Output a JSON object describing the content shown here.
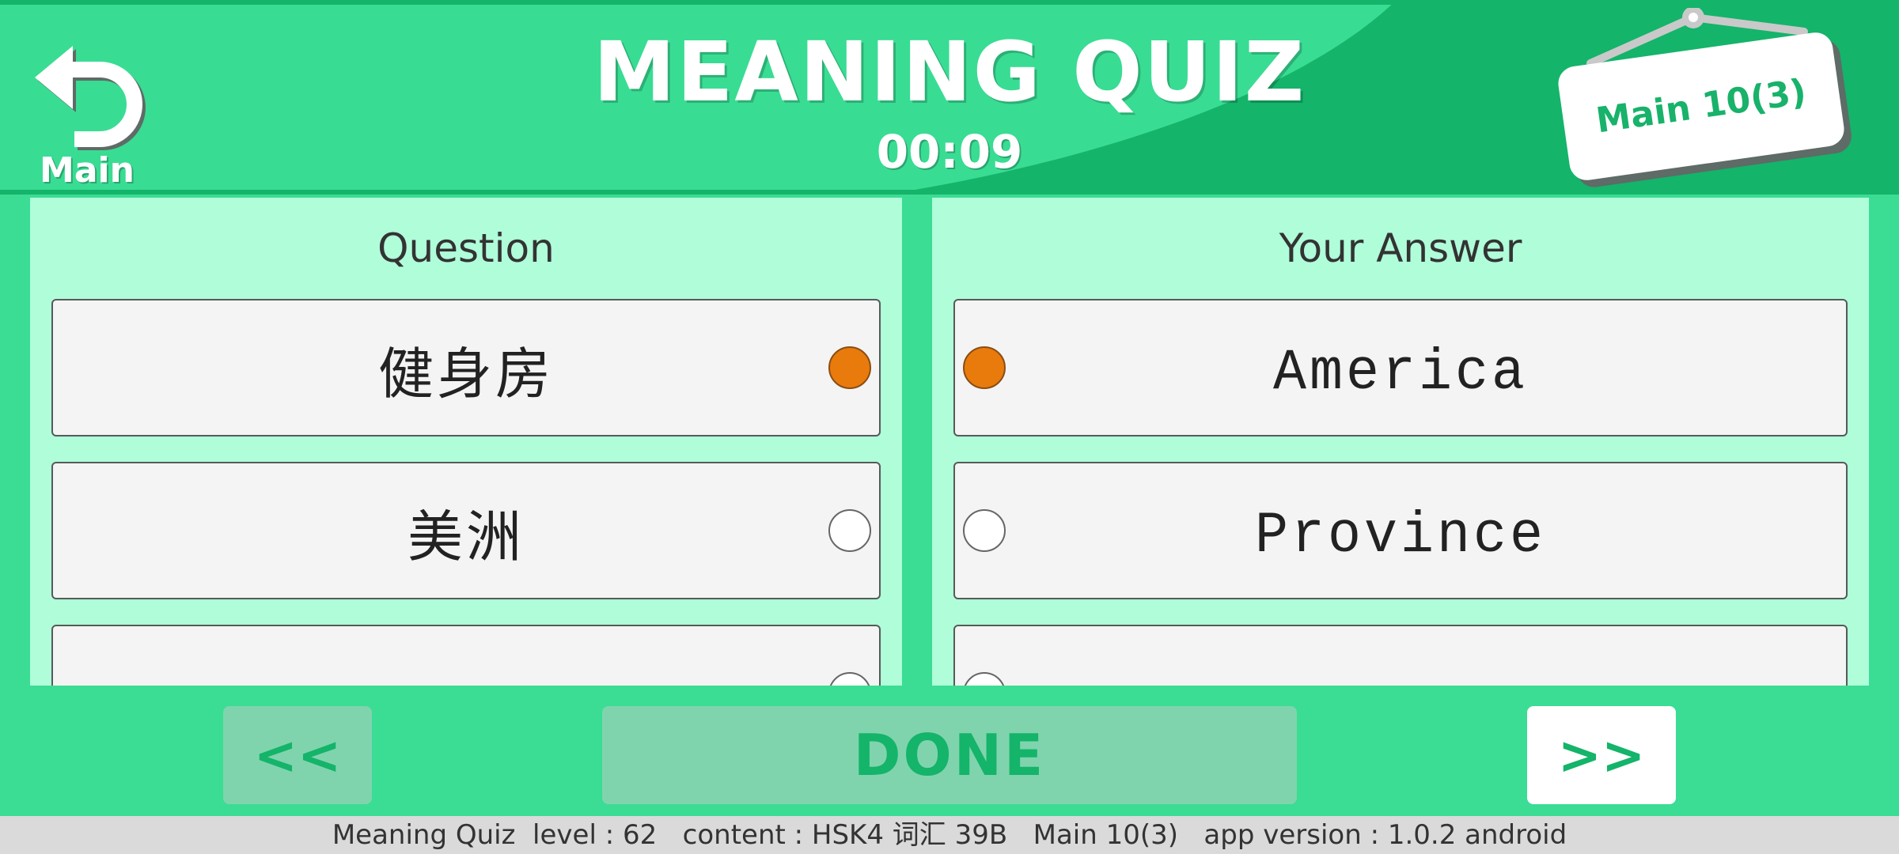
{
  "header": {
    "back_label": "Main",
    "title": "MEANING QUIZ",
    "timer": "00:09",
    "level_badge": "Main 10(3)"
  },
  "question_panel": {
    "title": "Question",
    "options": [
      {
        "text": "健身房",
        "selected": true
      },
      {
        "text": "美洲",
        "selected": false
      },
      {
        "text": "",
        "selected": false
      }
    ]
  },
  "answer_panel": {
    "title": "Your Answer",
    "options": [
      {
        "text": "America",
        "selected": true
      },
      {
        "text": "Province",
        "selected": false
      },
      {
        "text": "",
        "selected": false
      }
    ]
  },
  "controls": {
    "prev_label": "<<",
    "done_label": "DONE",
    "next_label": ">>"
  },
  "status_bar": {
    "text": "Meaning Quiz  level : 62   content : HSK4 词汇 39B   Main 10(3)   app version : 1.0.2 android"
  },
  "colors": {
    "background": "#3add93",
    "header_dark": "#14b46a",
    "panel": "#b0fdda",
    "selected_radio": "#e87b0c",
    "button_text": "#14b46a",
    "disabled_button": "#80d4ad"
  },
  "icons": {
    "back": "undo-arrow-icon",
    "radio_selected": "radio-filled-icon",
    "radio_empty": "radio-empty-icon"
  }
}
